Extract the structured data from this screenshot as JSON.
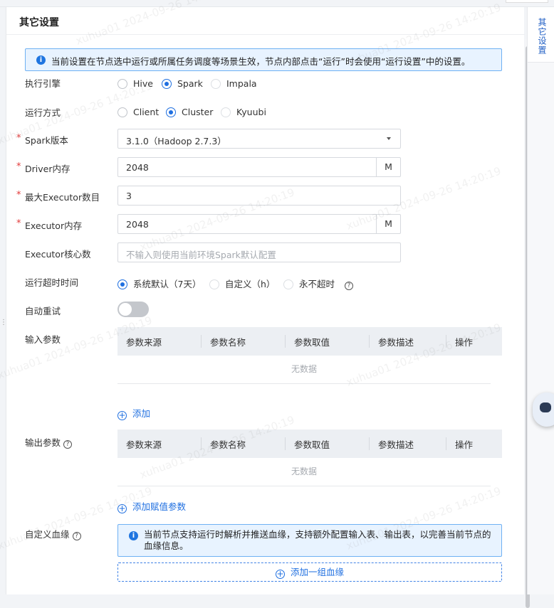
{
  "panel": {
    "title": "其它设置"
  },
  "right_rail": {
    "tab_label": "其它设置"
  },
  "notice": {
    "text": "当前设置在节点选中运行或所属任务调度等场景生效，节点内部点击“运行”时会使用“运行设置”中的设置。"
  },
  "engine": {
    "label": "执行引擎",
    "options": [
      "Hive",
      "Spark",
      "Impala"
    ],
    "selected": "Spark"
  },
  "run_mode": {
    "label": "运行方式",
    "options": [
      "Client",
      "Cluster",
      "Kyuubi"
    ],
    "selected": "Cluster"
  },
  "spark_version": {
    "label": "Spark版本",
    "value": "3.1.0（Hadoop 2.7.3）"
  },
  "driver_memory": {
    "label": "Driver内存",
    "value": "2048",
    "unit": "M"
  },
  "max_executors": {
    "label": "最大Executor数目",
    "value": "3"
  },
  "executor_memory": {
    "label": "Executor内存",
    "value": "2048",
    "unit": "M"
  },
  "executor_cores": {
    "label": "Executor核心数",
    "placeholder": "不输入则使用当前环境Spark默认配置"
  },
  "timeout": {
    "label": "运行超时时间",
    "options": [
      "系统默认（7天）",
      "自定义（h）",
      "永不超时"
    ],
    "selected": "系统默认（7天）"
  },
  "auto_retry": {
    "label": "自动重试",
    "enabled": false
  },
  "input_params": {
    "label": "输入参数",
    "columns": [
      "参数来源",
      "参数名称",
      "参数取值",
      "参数描述",
      "操作"
    ],
    "empty_text": "无数据",
    "add_label": "添加"
  },
  "output_params": {
    "label": "输出参数",
    "columns": [
      "参数来源",
      "参数名称",
      "参数取值",
      "参数描述",
      "操作"
    ],
    "empty_text": "无数据",
    "add_label": "添加赋值参数"
  },
  "lineage": {
    "label": "自定义血缘",
    "notice": "当前节点支持运行时解析并推送血缘，支持额外配置输入表、输出表，以完善当前节点的血缘信息。",
    "add_label": "添加一组血缘"
  },
  "watermark": {
    "text": "xuhua01 2024-09-26 14:20:19"
  },
  "colors": {
    "accent": "#1f6fe0",
    "required": "#e23b3b",
    "notice_bg": "#e8f3ff"
  }
}
